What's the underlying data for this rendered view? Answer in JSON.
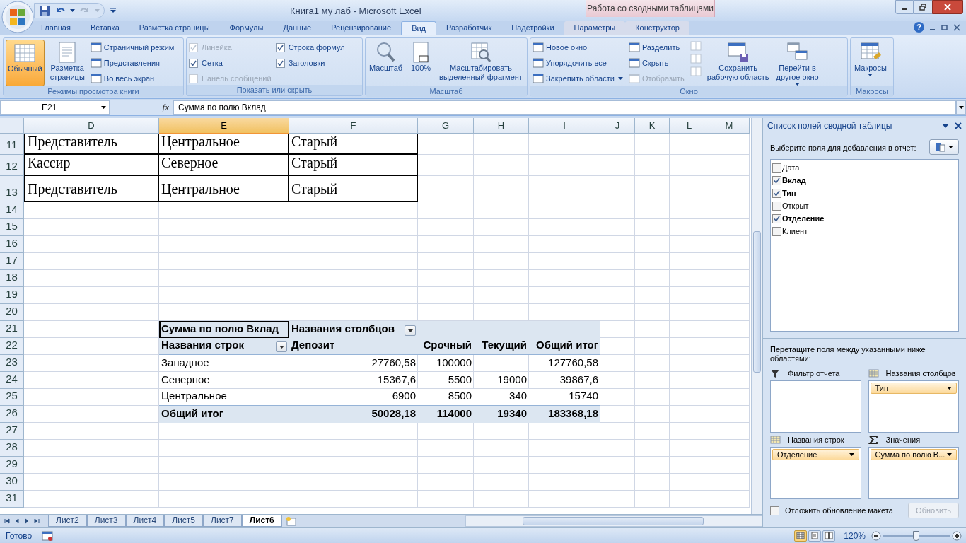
{
  "window": {
    "title": "Книга1 му лаб - Microsoft Excel",
    "context_tab": "Работа со сводными таблицами"
  },
  "ribbon_tabs": [
    {
      "label": "Главная",
      "selected": false,
      "contextual": false
    },
    {
      "label": "Вставка",
      "selected": false,
      "contextual": false
    },
    {
      "label": "Разметка страницы",
      "selected": false,
      "contextual": false
    },
    {
      "label": "Формулы",
      "selected": false,
      "contextual": false
    },
    {
      "label": "Данные",
      "selected": false,
      "contextual": false
    },
    {
      "label": "Рецензирование",
      "selected": false,
      "contextual": false
    },
    {
      "label": "Вид",
      "selected": true,
      "contextual": false
    },
    {
      "label": "Разработчик",
      "selected": false,
      "contextual": false
    },
    {
      "label": "Надстройки",
      "selected": false,
      "contextual": false
    },
    {
      "label": "Параметры",
      "selected": false,
      "contextual": true
    },
    {
      "label": "Конструктор",
      "selected": false,
      "contextual": true
    }
  ],
  "help_button": "?",
  "ribbon_groups": [
    {
      "label": "Режимы просмотра книги",
      "columns": [
        [
          {
            "kind": "large",
            "label": "Обычный",
            "selected": true,
            "disabled": false
          }
        ],
        [
          {
            "kind": "large",
            "label": "Разметка\nстраницы",
            "selected": false,
            "disabled": false
          }
        ],
        [
          {
            "kind": "small",
            "label": "Страничный режим",
            "selected": false,
            "disabled": false
          },
          {
            "kind": "small",
            "label": "Представления",
            "selected": false,
            "disabled": false
          },
          {
            "kind": "small",
            "label": "Во весь экран",
            "selected": false,
            "disabled": false
          }
        ]
      ]
    },
    {
      "label": "Показать или скрыть",
      "columns": [
        [
          {
            "kind": "check",
            "label": "Линейка",
            "checked": true,
            "disabled": true
          },
          {
            "kind": "check",
            "label": "Сетка",
            "checked": true,
            "disabled": false
          },
          {
            "kind": "check",
            "label": "Панель сообщений",
            "checked": false,
            "disabled": true
          }
        ],
        [
          {
            "kind": "check",
            "label": "Строка формул",
            "checked": true,
            "disabled": false
          },
          {
            "kind": "check",
            "label": "Заголовки",
            "checked": true,
            "disabled": false
          }
        ]
      ]
    },
    {
      "label": "Масштаб",
      "columns": [
        [
          {
            "kind": "large",
            "label": "Масштаб",
            "disabled": false
          }
        ],
        [
          {
            "kind": "large",
            "label": "100%",
            "disabled": false
          }
        ],
        [
          {
            "kind": "large",
            "label": "Масштабировать\nвыделенный фрагмент",
            "disabled": false
          }
        ]
      ]
    },
    {
      "label": "Окно",
      "columns": [
        [
          {
            "kind": "small",
            "label": "Новое окно",
            "disabled": false,
            "has_menu": false
          },
          {
            "kind": "small",
            "label": "Упорядочить все",
            "disabled": false,
            "has_menu": false
          },
          {
            "kind": "small",
            "label": "Закрепить области",
            "disabled": false,
            "has_menu": true
          }
        ],
        [
          {
            "kind": "small",
            "label": "Разделить",
            "disabled": false,
            "has_menu": false
          },
          {
            "kind": "small",
            "label": "Скрыть",
            "disabled": false,
            "has_menu": false
          },
          {
            "kind": "small",
            "label": "Отобразить",
            "disabled": true,
            "has_menu": false
          }
        ],
        [
          {
            "kind": "icon",
            "disabled": true
          },
          {
            "kind": "icon",
            "disabled": true
          },
          {
            "kind": "icon",
            "disabled": true
          }
        ],
        [
          {
            "kind": "large",
            "label": "Сохранить\nрабочую область",
            "disabled": false,
            "has_menu": false
          }
        ],
        [
          {
            "kind": "large",
            "label": "Перейти в\nдругое окно",
            "disabled": false,
            "has_menu": true
          }
        ]
      ]
    },
    {
      "label": "Макросы",
      "columns": [
        [
          {
            "kind": "large",
            "label": "Макросы",
            "disabled": false,
            "has_menu": true
          }
        ]
      ]
    }
  ],
  "formula_bar": {
    "name_box": "E21",
    "fx": "fx",
    "formula": "Сумма по полю Вклад"
  },
  "sheet": {
    "columns": [
      {
        "label": "D",
        "selected": false
      },
      {
        "label": "E",
        "selected": true
      },
      {
        "label": "F",
        "selected": false
      },
      {
        "label": "G",
        "selected": false
      },
      {
        "label": "H",
        "selected": false
      },
      {
        "label": "I",
        "selected": false
      },
      {
        "label": "J",
        "selected": false
      },
      {
        "label": "K",
        "selected": false
      },
      {
        "label": "L",
        "selected": false
      },
      {
        "label": "M",
        "selected": false
      }
    ],
    "row_numbers": [
      "11",
      "12",
      "13",
      "14",
      "15",
      "16",
      "17",
      "18",
      "19",
      "20",
      "21",
      "22",
      "23",
      "24",
      "25",
      "26",
      "27",
      "28",
      "29",
      "30",
      "31"
    ],
    "data_rows": [
      [
        "Представитель",
        "Центральное",
        "Старый"
      ],
      [
        "Кассир",
        "Северное",
        "Старый"
      ],
      [
        "Представитель",
        "Центральное",
        "Старый"
      ]
    ],
    "pivot_table": {
      "value_field": "Сумма по полю Вклад",
      "value_field_selected": true,
      "column_labels": "Названия столбцов",
      "row_labels": "Названия строк",
      "columns": [
        "Депозит",
        "Срочный",
        "Текущий",
        "Общий итог"
      ],
      "rows": [
        {
          "label": "Западное",
          "values": {
            "deposit": "27760,58",
            "fixed_term": "100000",
            "grand_total": "127760,58"
          }
        },
        {
          "label": "Северное",
          "values": {
            "deposit": "15367,6",
            "fixed_term": "5500",
            "current": "19000",
            "grand_total": "39867,6"
          }
        },
        {
          "label": "Центральное",
          "values": {
            "deposit": "6900",
            "fixed_term": "8500",
            "current": "340",
            "grand_total": "15740"
          }
        }
      ],
      "total": {
        "label": "Общий итог",
        "values": {
          "deposit": "50028,18",
          "fixed_term": "114000",
          "current": "19340",
          "grand_total": "183368,18"
        }
      }
    }
  },
  "sheet_tabs": [
    {
      "label": "Лист2",
      "selected": false
    },
    {
      "label": "Лист3",
      "selected": false
    },
    {
      "label": "Лист4",
      "selected": false
    },
    {
      "label": "Лист5",
      "selected": false
    },
    {
      "label": "Лист7",
      "selected": false
    },
    {
      "label": "Лист6",
      "selected": true
    }
  ],
  "field_list": {
    "title": "Список полей сводной таблицы",
    "prompt": "Выберите поля для добавления в отчет:",
    "fields": [
      {
        "label": "Дата",
        "checked": false
      },
      {
        "label": "Вклад",
        "checked": true
      },
      {
        "label": "Тип",
        "checked": true
      },
      {
        "label": "Открыт",
        "checked": false
      },
      {
        "label": "Отделение",
        "checked": true
      },
      {
        "label": "Клиент",
        "checked": false
      }
    ],
    "instruction": "Перетащите поля между указанными ниже областями:",
    "areas": [
      {
        "kind": "filter",
        "label": "Фильтр отчета"
      },
      {
        "kind": "columns",
        "label": "Названия столбцов",
        "items": [
          "Тип"
        ]
      },
      {
        "kind": "rows",
        "label": "Названия строк",
        "items": [
          "Отделение"
        ]
      },
      {
        "kind": "values",
        "label": "Значения",
        "items": [
          "Сумма по полю В..."
        ]
      }
    ],
    "defer_update": {
      "label": "Отложить обновление макета",
      "checked": false
    },
    "update_button": {
      "label": "Обновить",
      "disabled": true
    }
  },
  "status_bar": {
    "status": "Готово",
    "view_buttons": [
      {
        "selected": true
      },
      {
        "selected": false
      },
      {
        "selected": false
      }
    ],
    "zoom": "120%",
    "zoom_level": {
      "level": 0.49
    }
  }
}
